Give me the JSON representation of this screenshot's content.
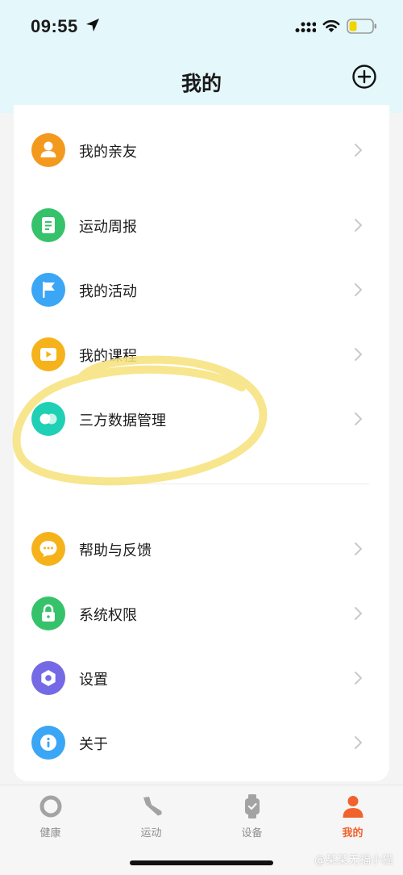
{
  "status_bar": {
    "time": "09:55",
    "icons": [
      "location-arrow-icon",
      "signal-icon",
      "wifi-icon",
      "battery-icon"
    ]
  },
  "header": {
    "title": "我的",
    "add_icon": "plus-circle-icon"
  },
  "menu": {
    "items": [
      {
        "label": "我的亲友",
        "icon": "person-icon",
        "color": "#f39a1e"
      },
      {
        "label": "运动周报",
        "icon": "document-icon",
        "color": "#36c26a"
      },
      {
        "label": "我的活动",
        "icon": "flag-icon",
        "color": "#3aa6f5"
      },
      {
        "label": "我的课程",
        "icon": "play-icon",
        "color": "#f6b21a"
      },
      {
        "label": "三方数据管理",
        "icon": "link-circles-icon",
        "color": "#1fd0b5"
      },
      {
        "label": "帮助与反馈",
        "icon": "chat-bubble-icon",
        "color": "#f6b21a"
      },
      {
        "label": "系统权限",
        "icon": "lock-icon",
        "color": "#36c26a"
      },
      {
        "label": "设置",
        "icon": "gear-hexagon-icon",
        "color": "#7569e6"
      },
      {
        "label": "关于",
        "icon": "info-icon",
        "color": "#3aa6f5"
      }
    ]
  },
  "tab_bar": {
    "tabs": [
      {
        "label": "健康",
        "icon": "ring-icon",
        "active": false
      },
      {
        "label": "运动",
        "icon": "shoe-icon",
        "active": false
      },
      {
        "label": "设备",
        "icon": "watch-icon",
        "active": false
      },
      {
        "label": "我的",
        "icon": "user-icon",
        "active": true
      }
    ],
    "active_color": "#f0632d"
  },
  "watermark": "@某某无福小猫"
}
